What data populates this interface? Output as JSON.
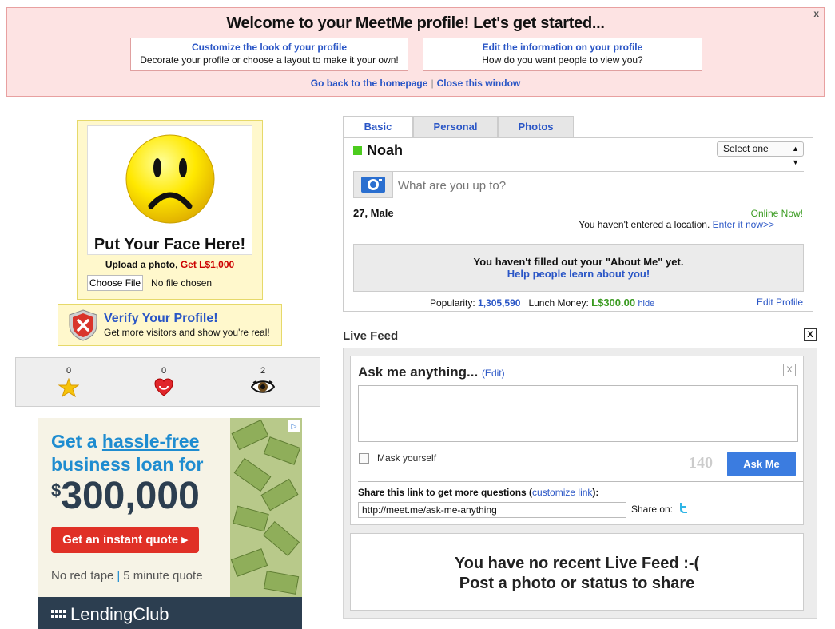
{
  "welcome": {
    "title": "Welcome to your MeetMe profile! Let's get started...",
    "close": "x",
    "customize": {
      "heading": "Customize the look of your profile",
      "sub": "Decorate your profile or choose a layout to make it your own!"
    },
    "edit_info": {
      "heading": "Edit the information on your profile",
      "sub": "How do you want people to view you?"
    },
    "homepage_link": "Go back to the homepage",
    "separator": "|",
    "close_window_link": "Close this window"
  },
  "photo": {
    "put_face": "Put Your Face Here!",
    "upload_text": "Upload a photo, ",
    "upload_reward": "Get L$1,000",
    "choose_file": "Choose File",
    "no_file": "No file chosen"
  },
  "verify": {
    "title": "Verify Your Profile!",
    "subtitle": "Get more visitors and show you're real!"
  },
  "stats": {
    "favorites": "0",
    "hearts": "0",
    "views": "2"
  },
  "ad": {
    "adchoices": "▷",
    "line1_prefix": "Get a ",
    "line1_link": "hassle-free",
    "line2": "business loan for",
    "currency": "$",
    "amount": "300,000",
    "cta": "Get an instant quote ▸",
    "tag1": "No red tape",
    "tag_sep": "|",
    "tag2": "5 minute quote",
    "brand": "LendingClub"
  },
  "tabs": [
    {
      "label": "Basic"
    },
    {
      "label": "Personal"
    },
    {
      "label": "Photos"
    }
  ],
  "profile": {
    "name": "Noah",
    "select_value": "Select one",
    "status_placeholder": "What are you up to?",
    "age_gender": "27, Male",
    "online": "Online Now!",
    "location_text": "You haven't entered a location. ",
    "location_link": "Enter it now>>",
    "about_missing": "You haven't filled out your \"About Me\" yet.",
    "about_link": "Help people learn about you!",
    "popularity_label": "Popularity: ",
    "popularity_value": "1,305,590",
    "lunch_label": "Lunch Money: ",
    "lunch_value": "L$300.00",
    "hide": "hide",
    "edit_profile": "Edit Profile"
  },
  "live_feed": {
    "label": "Live Feed",
    "close": "X",
    "ask": {
      "title": "Ask me anything...",
      "edit": "(Edit)",
      "close": "X",
      "mask": "Mask yourself",
      "count": "140",
      "button": "Ask Me",
      "share_label_prefix": "Share this link to get more questions (",
      "share_customize": "customize link",
      "share_label_suffix": "):",
      "share_url": "http://meet.me/ask-me-anything",
      "share_on": "Share on:"
    },
    "empty_line1": "You have no recent Live Feed :-(",
    "empty_line2": "Post a photo or status to share"
  },
  "colors": {
    "link": "#2a56c6",
    "online_green": "#4ccc1e",
    "ask_button": "#3b7ce0",
    "banner_bg": "#fde3e3",
    "yellow_box": "#fff8cc"
  }
}
